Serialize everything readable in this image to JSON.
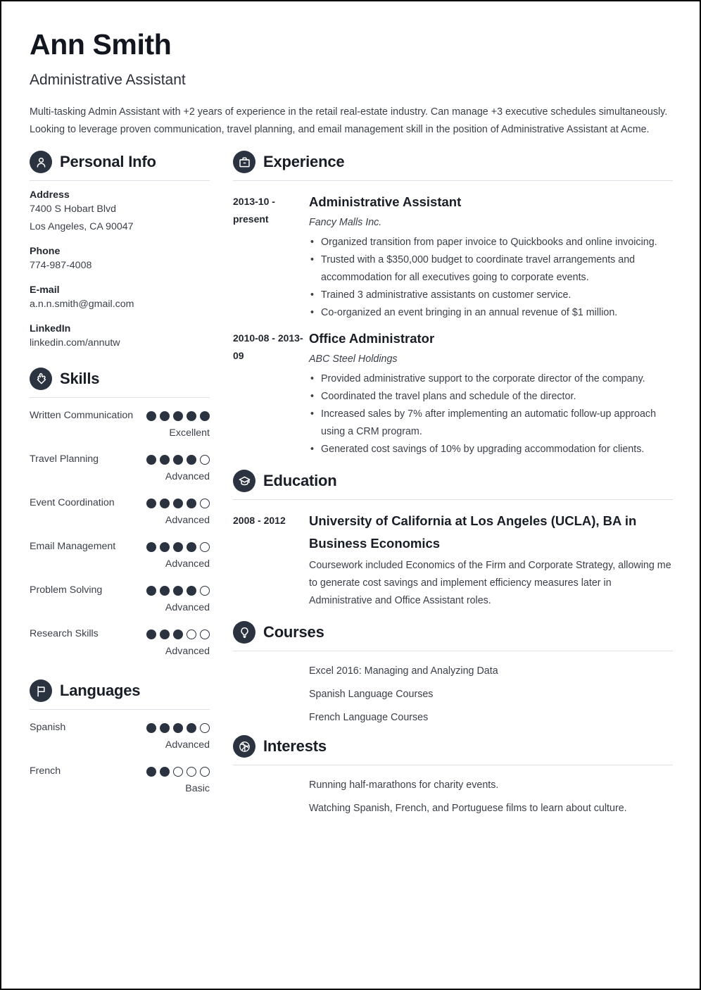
{
  "header": {
    "name": "Ann Smith",
    "job_title": "Administrative Assistant",
    "summary": "Multi-tasking Admin Assistant with +2 years of experience in the retail real-estate industry. Can manage +3 executive schedules simultaneously. Looking to leverage proven communication, travel planning, and email management skill in the position of Administrative Assistant at Acme."
  },
  "colors": {
    "icon_badge": "#2b3340",
    "text": "#3a3f48",
    "heading": "#181d26",
    "rule": "#dcdfe3"
  },
  "personal_info": {
    "title": "Personal Info",
    "icon": "person-icon",
    "fields": [
      {
        "label": "Address",
        "value": "7400 S Hobart Blvd",
        "value2": "Los Angeles, CA 90047"
      },
      {
        "label": "Phone",
        "value": "774-987-4008"
      },
      {
        "label": "E-mail",
        "value": "a.n.n.smith@gmail.com"
      },
      {
        "label": "LinkedIn",
        "value": "linkedin.com/annutw"
      }
    ]
  },
  "skills": {
    "title": "Skills",
    "icon": "puzzle-icon",
    "max_dots": 5,
    "items": [
      {
        "name": "Written Communication",
        "filled": 5,
        "level": "Excellent"
      },
      {
        "name": "Travel Planning",
        "filled": 4,
        "level": "Advanced"
      },
      {
        "name": "Event Coordination",
        "filled": 4,
        "level": "Advanced"
      },
      {
        "name": "Email Management",
        "filled": 4,
        "level": "Advanced"
      },
      {
        "name": "Problem Solving",
        "filled": 4,
        "level": "Advanced"
      },
      {
        "name": "Research Skills",
        "filled": 3,
        "level": "Advanced"
      }
    ]
  },
  "languages": {
    "title": "Languages",
    "icon": "flag-icon",
    "max_dots": 5,
    "items": [
      {
        "name": "Spanish",
        "filled": 4,
        "level": "Advanced"
      },
      {
        "name": "French",
        "filled": 2,
        "level": "Basic"
      }
    ]
  },
  "experience": {
    "title": "Experience",
    "icon": "briefcase-icon",
    "entries": [
      {
        "date": "2013-10 - present",
        "title": "Administrative Assistant",
        "subtitle": "Fancy Malls Inc.",
        "bullets": [
          "Organized transition from paper invoice to Quickbooks and online invoicing.",
          "Trusted with a $350,000 budget to coordinate travel arrangements and accommodation for all executives going to corporate events.",
          "Trained 3 administrative assistants on customer service.",
          "Co-organized an event bringing in an annual revenue of $1 million."
        ]
      },
      {
        "date": "2010-08 - 2013-09",
        "title": "Office Administrator",
        "subtitle": "ABC Steel Holdings",
        "bullets": [
          "Provided administrative support to the corporate director of the company.",
          "Coordinated the travel plans and schedule of the director.",
          "Increased sales by 7% after implementing an automatic follow-up approach using a CRM program.",
          "Generated cost savings of 10% by upgrading accommodation for clients."
        ]
      }
    ]
  },
  "education": {
    "title": "Education",
    "icon": "graduation-cap-icon",
    "entries": [
      {
        "date": "2008 - 2012",
        "title": "University of California at Los Angeles (UCLA), BA in Business Economics",
        "description": "Coursework included Economics of the Firm and Corporate Strategy, allowing me to generate cost savings and implement efficiency measures later in Administrative and Office Assistant roles."
      }
    ]
  },
  "courses": {
    "title": "Courses",
    "icon": "lightbulb-icon",
    "items": [
      "Excel 2016: Managing and Analyzing Data",
      "Spanish Language Courses",
      "French Language Courses"
    ]
  },
  "interests": {
    "title": "Interests",
    "icon": "ball-icon",
    "items": [
      "Running half-marathons for charity events.",
      "Watching Spanish, French, and Portuguese films to learn about culture."
    ]
  }
}
